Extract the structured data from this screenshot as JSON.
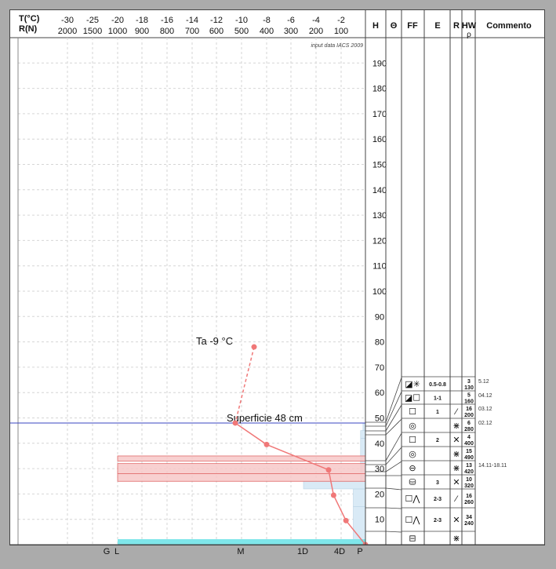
{
  "header": {
    "t_label": "T(°C)",
    "r_label": "R(N)",
    "t_ticks": [
      "-30",
      "-25",
      "-20",
      "-18",
      "-16",
      "-14",
      "-12",
      "-10",
      "-8",
      "-6",
      "-4",
      "-2"
    ],
    "r_ticks": [
      "2000",
      "1500",
      "1000",
      "900",
      "800",
      "700",
      "600",
      "500",
      "400",
      "300",
      "200",
      "100"
    ],
    "columns": {
      "h": "H",
      "theta": "Θ",
      "ff": "FF",
      "e": "E",
      "r": "R",
      "hw": "HW",
      "rho": "ρ",
      "comment": "Commento"
    }
  },
  "source_note": "input data IACS 2009",
  "hardness_scale": [
    "G",
    "L",
    "M",
    "1D",
    "4D",
    "P"
  ],
  "colors": {
    "temp": "#f07878",
    "snow_line": "#3a44c0",
    "ram": "#d9eaf6",
    "layer_band": "#f7c8c8",
    "ground": "#7fe6ea"
  },
  "chart_data": {
    "type": "snow-profile",
    "h_axis": {
      "min": 0,
      "max": 200,
      "ticks": [
        10,
        20,
        30,
        40,
        50,
        60,
        70,
        80,
        90,
        100,
        110,
        120,
        130,
        140,
        150,
        160,
        170,
        180,
        190
      ]
    },
    "snow_surface_cm": 48,
    "surface_label": "Superficie  48 cm",
    "air_temp": {
      "label": "Ta  -9 °C",
      "value_c": -9,
      "h": 78
    },
    "temperature_profile": [
      {
        "h": 48,
        "t": -10.5
      },
      {
        "h": 39.5,
        "t": -8
      },
      {
        "h": 29.5,
        "t": -3
      },
      {
        "h": 19.5,
        "t": -2.6
      },
      {
        "h": 9.5,
        "t": -1.6
      },
      {
        "h": 0,
        "t": 0
      }
    ],
    "ram_profile": [
      {
        "h0": 0,
        "h1": 15,
        "r": 50
      },
      {
        "h0": 15,
        "h1": 22,
        "r": 50
      },
      {
        "h0": 22,
        "h1": 25,
        "r": 250
      },
      {
        "h0": 25,
        "h1": 28,
        "r": 20
      },
      {
        "h0": 28,
        "h1": 35,
        "r": 20
      },
      {
        "h0": 35,
        "h1": 42,
        "r": 20
      },
      {
        "h0": 42,
        "h1": 45,
        "r": 20
      },
      {
        "h0": 45,
        "h1": 48,
        "r": 10
      }
    ],
    "hardness_bands": [
      {
        "h0": 25,
        "h1": 28
      },
      {
        "h0": 28,
        "h1": 32
      },
      {
        "h0": 33,
        "h1": 35
      }
    ],
    "layers": [
      {
        "ff": "◪✳",
        "e": "0.5-0.8",
        "r": "",
        "hw": "3",
        "rho": "130",
        "comment": "5.12"
      },
      {
        "ff": "◪☐",
        "e": "1-1",
        "r": "",
        "hw": "5",
        "rho": "160",
        "comment": "04.12"
      },
      {
        "ff": "☐",
        "e": "1",
        "r": "⁄",
        "hw": "16",
        "rho": "200",
        "comment": "03.12"
      },
      {
        "ff": "◎",
        "e": "",
        "r": "⋇",
        "hw": "6",
        "rho": "280",
        "comment": "02.12"
      },
      {
        "ff": "☐",
        "e": "2",
        "r": "✕",
        "hw": "4",
        "rho": "400",
        "comment": ""
      },
      {
        "ff": "◎",
        "e": "",
        "r": "⋇",
        "hw": "15",
        "rho": "490",
        "comment": ""
      },
      {
        "ff": "⊖",
        "e": "",
        "r": "⋇",
        "hw": "13",
        "rho": "420",
        "comment": "14.11-18.11"
      },
      {
        "ff": "⛁",
        "e": "3",
        "r": "✕",
        "hw": "10",
        "rho": "320",
        "comment": ""
      },
      {
        "ff": "☐⋀",
        "e": "2-3",
        "r": "⁄",
        "hw": "16",
        "rho": "260",
        "comment": ""
      },
      {
        "ff": "☐⋀",
        "e": "2-3",
        "r": "✕",
        "hw": "34",
        "rho": "240",
        "comment": ""
      },
      {
        "ff": "⊟",
        "e": "",
        "r": "⋇",
        "hw": "",
        "rho": "",
        "comment": ""
      }
    ]
  }
}
